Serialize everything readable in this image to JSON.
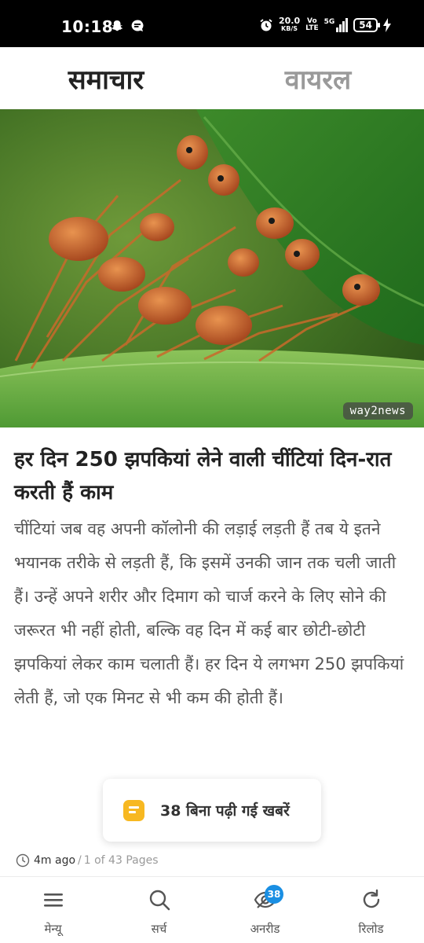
{
  "status_bar": {
    "time": "10:18",
    "speed_value": "20.0",
    "speed_unit": "KB/S",
    "volte_top": "Vo",
    "volte_bottom": "LTE",
    "network": "5G",
    "battery": "54"
  },
  "tabs": [
    {
      "label": "समाचार",
      "active": true
    },
    {
      "label": "वायरल",
      "active": false
    }
  ],
  "accent_color": "#1a8fe3",
  "hero": {
    "watermark": "way2news"
  },
  "article": {
    "headline": "हर दिन 250 झपकियां लेने वाली चींटियां दिन-रात करती हैं काम",
    "body": "चींटियां जब वह अपनी कॉलोनी की लड़ाई लड़ती हैं तब ये इतने भयानक तरीके से लड़ती हैं, कि इसमें उनकी जान तक चली जाती हैं। उन्हें अपने शरीर और दिमाग को चार्ज करने के लिए सोने की जरूरत भी नहीं होती, बल्कि वह दिन में कई बार छोटी-छोटी झपकियां लेकर काम चलाती हैं। हर दिन ये लगभग 250 झपकियां लेती हैं, जो एक मिनट से भी कम की होती हैं।"
  },
  "unread_pill": {
    "text": "38 बिना पढ़ी गई खबरें",
    "icon": "news-icon"
  },
  "meta": {
    "time_ago": "4m ago",
    "separator": "/",
    "pages": "1 of 43 Pages"
  },
  "bottom_nav": [
    {
      "label": "मेन्यू",
      "icon": "menu-icon"
    },
    {
      "label": "सर्च",
      "icon": "search-icon"
    },
    {
      "label": "अनरीड",
      "icon": "unread-eye-icon",
      "badge": "38"
    },
    {
      "label": "रिलोड",
      "icon": "reload-icon"
    }
  ]
}
